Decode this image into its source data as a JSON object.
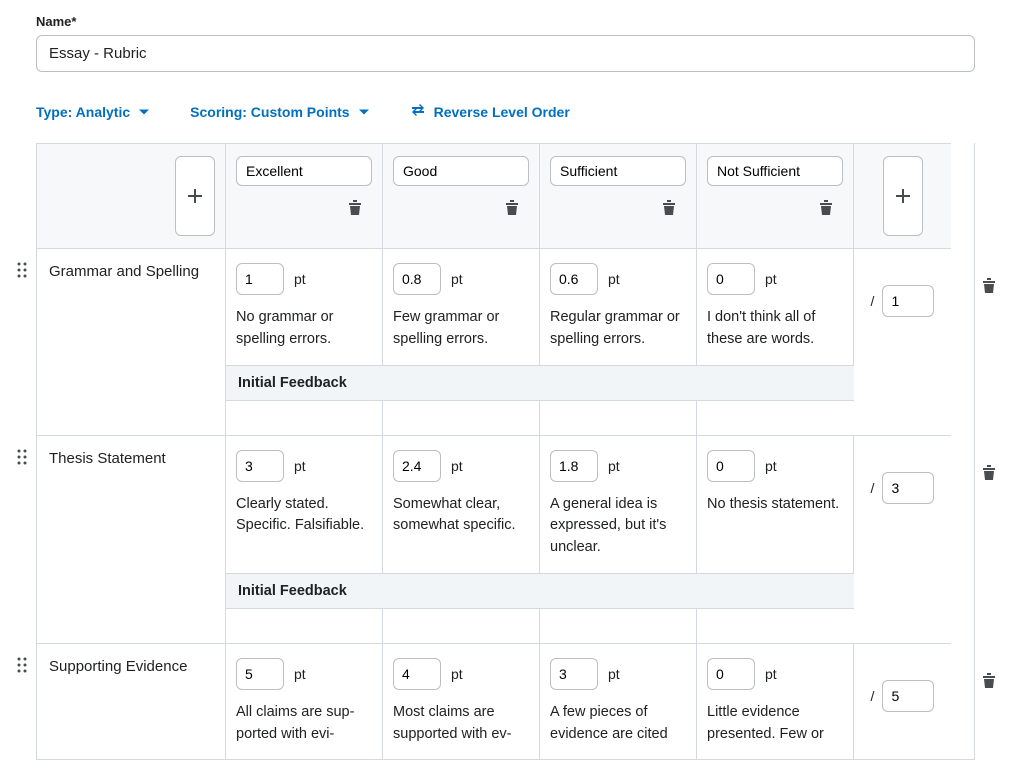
{
  "nameLabel": "Name*",
  "nameValue": "Essay - Rubric",
  "toolbar": {
    "type": "Type: Analytic",
    "scoring": "Scoring: Custom Points",
    "reverse": "Reverse Level Order"
  },
  "levels": [
    "Excellent",
    "Good",
    "Sufficient",
    "Not Sufficient"
  ],
  "ptLabel": "pt",
  "feedbackLabel": "Initial Feedback",
  "criteria": [
    {
      "name": "Grammar and Spelling",
      "total": "1",
      "cells": [
        {
          "pt": "1",
          "desc": "No grammar or spelling errors."
        },
        {
          "pt": "0.8",
          "desc": "Few grammar or spelling errors."
        },
        {
          "pt": "0.6",
          "desc": "Regular grammar or spelling errors."
        },
        {
          "pt": "0",
          "desc": "I don't think all of these are words."
        }
      ]
    },
    {
      "name": "Thesis Statement",
      "total": "3",
      "cells": [
        {
          "pt": "3",
          "desc": "Clearly stated. Specific. Falsifiable."
        },
        {
          "pt": "2.4",
          "desc": "Somewhat clear, somewhat specific."
        },
        {
          "pt": "1.8",
          "desc": "A general idea is expressed, but it's unclear."
        },
        {
          "pt": "0",
          "desc": "No thesis state­ment."
        }
      ]
    },
    {
      "name": "Supporting Evidence",
      "total": "5",
      "cells": [
        {
          "pt": "5",
          "desc": "All claims are sup­ported with evi-"
        },
        {
          "pt": "4",
          "desc": "Most claims are supported with ev-"
        },
        {
          "pt": "3",
          "desc": "A few pieces of evidence are cited"
        },
        {
          "pt": "0",
          "desc": "Little evidence presented. Few or"
        }
      ]
    }
  ]
}
